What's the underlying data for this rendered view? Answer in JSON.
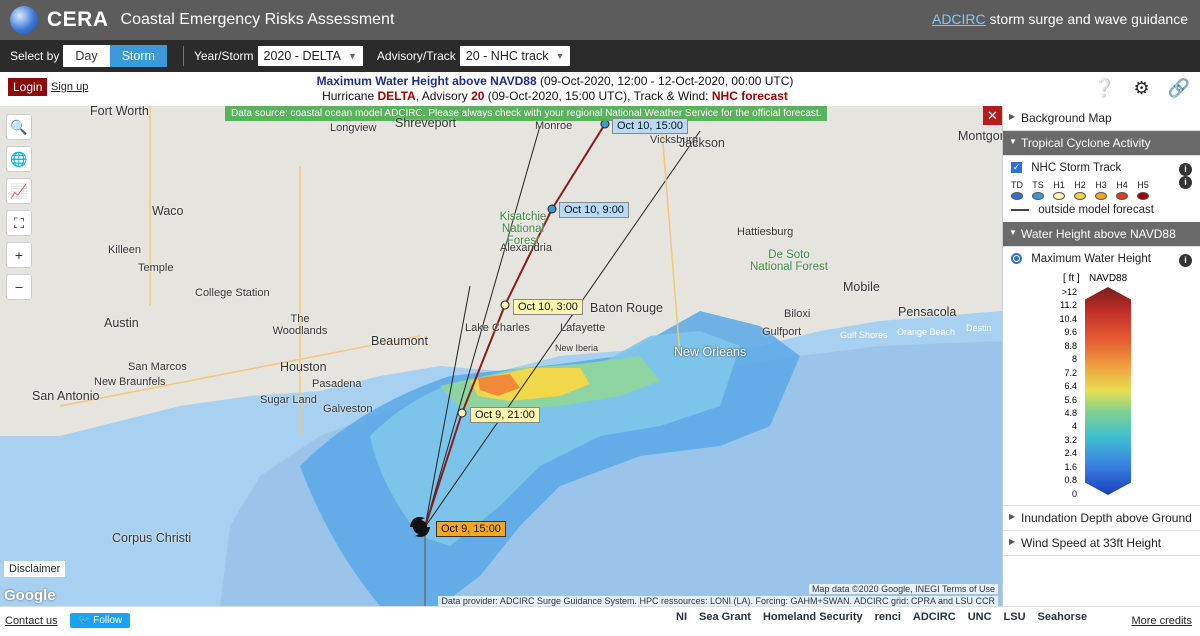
{
  "header": {
    "brand": "CERA",
    "subtitle": "Coastal Emergency Risks Assessment",
    "right_link": "ADCIRC",
    "right_text": "storm surge and wave guidance"
  },
  "toolbar": {
    "select_by_label": "Select by",
    "day_label": "Day",
    "storm_label": "Storm",
    "year_storm_label": "Year/Storm",
    "year_storm_value": "2020 - DELTA",
    "advisory_label": "Advisory/Track",
    "advisory_value": "20 - NHC track"
  },
  "titlebar": {
    "login": "Login",
    "signup": "Sign up",
    "line1_bold": "Maximum Water Height above NAVD88",
    "line1_rest": "(09-Oct-2020, 12:00 - 12-Oct-2020, 00:00 UTC)",
    "line2_a": "Hurricane",
    "line2_storm": "DELTA",
    "line2_b": ", Advisory",
    "line2_adv": "20",
    "line2_c": "(09-Oct-2020, 15:00 UTC), Track & Wind:",
    "line2_track": "NHC forecast"
  },
  "map": {
    "datasource": "Data source: coastal ocean model ADCIRC. Please always check with your regional National Weather Service for the official forecast.",
    "disclaimer": "Disclaimer",
    "google": "Google",
    "mapdata": "Map data ©2020 Google, INEGI   Terms of Use",
    "track_labels": {
      "t1": "Oct 10, 15:00",
      "t2": "Oct 10, 9:00",
      "t3": "Oct 10, 3:00",
      "t4": "Oct 9, 21:00",
      "t5": "Oct 9, 15:00"
    },
    "cities": {
      "fort_worth": "Fort Worth",
      "longview": "Longview",
      "shreveport": "Shreveport",
      "monroe": "Monroe",
      "vicksburg": "Vicksburg",
      "jackson": "Jackson",
      "montgomery": "Montgor",
      "waco": "Waco",
      "killeen": "Killeen",
      "temple": "Temple",
      "kisatchie": "Kisatchie National Forest",
      "alexandria": "Alexandria",
      "hattiesburg": "Hattiesburg",
      "desoto": "De Soto National Forest",
      "college_station": "College Station",
      "austin": "Austin",
      "the_woodlands": "The Woodlands",
      "lake_charles": "Lake Charles",
      "lafayette": "Lafayette",
      "baton_rouge": "Baton Rouge",
      "mobile": "Mobile",
      "pensacola": "Pensacola",
      "beaumont": "Beaumont",
      "new_iberia": "New Iberia",
      "gulfport": "Gulfport",
      "biloxi": "Biloxi",
      "gulf_shores": "Gulf Shores",
      "orange_beach": "Orange Beach",
      "destin": "Destin",
      "new_orleans": "New Orleans",
      "san_marcos": "San Marcos",
      "new_braunfels": "New Braunfels",
      "houston": "Houston",
      "pasadena": "Pasadena",
      "sugar_land": "Sugar Land",
      "galveston": "Galveston",
      "san_antonio": "San Antonio",
      "corpus_christi": "Corpus Christi"
    }
  },
  "sidebar": {
    "background_map": "Background Map",
    "tropical": "Tropical Cyclone Activity",
    "nhc_storm_track": "NHC Storm Track",
    "categories": [
      {
        "label": "TD",
        "color": "#2f6fd6"
      },
      {
        "label": "TS",
        "color": "#3a9ad9"
      },
      {
        "label": "H1",
        "color": "#fff6b0"
      },
      {
        "label": "H2",
        "color": "#f5d142"
      },
      {
        "label": "H3",
        "color": "#f5a623"
      },
      {
        "label": "H4",
        "color": "#e03a1a"
      },
      {
        "label": "H5",
        "color": "#a30000"
      }
    ],
    "outside_forecast": "outside model forecast",
    "water_height": "Water Height above NAVD88",
    "max_water_height": "Maximum Water Height",
    "legend_unit": "[ ft ]",
    "legend_datum": "NAVD88",
    "legend_values": [
      ">12",
      "11.2",
      "10.4",
      "9.6",
      "8.8",
      "8",
      "7.2",
      "6.4",
      "5.6",
      "4.8",
      "4",
      "3.2",
      "2.4",
      "1.6",
      "0.8",
      "0"
    ],
    "inundation": "Inundation Depth above Ground",
    "wind_speed": "Wind Speed at 33ft Height"
  },
  "footer": {
    "contact": "Contact us",
    "follow": "Follow",
    "provider": "Data provider: ADCIRC Surge Guidance System. HPC ressources: LONI (LA). Forcing: GAHM+SWAN. ADCIRC grid: CPRA and LSU CCR",
    "logos": [
      "NI",
      "Sea Grant",
      "Homeland Security",
      "renci",
      "ADCIRC",
      "UNC",
      "LSU",
      "Seahorse"
    ],
    "more_credits": "More credits"
  }
}
